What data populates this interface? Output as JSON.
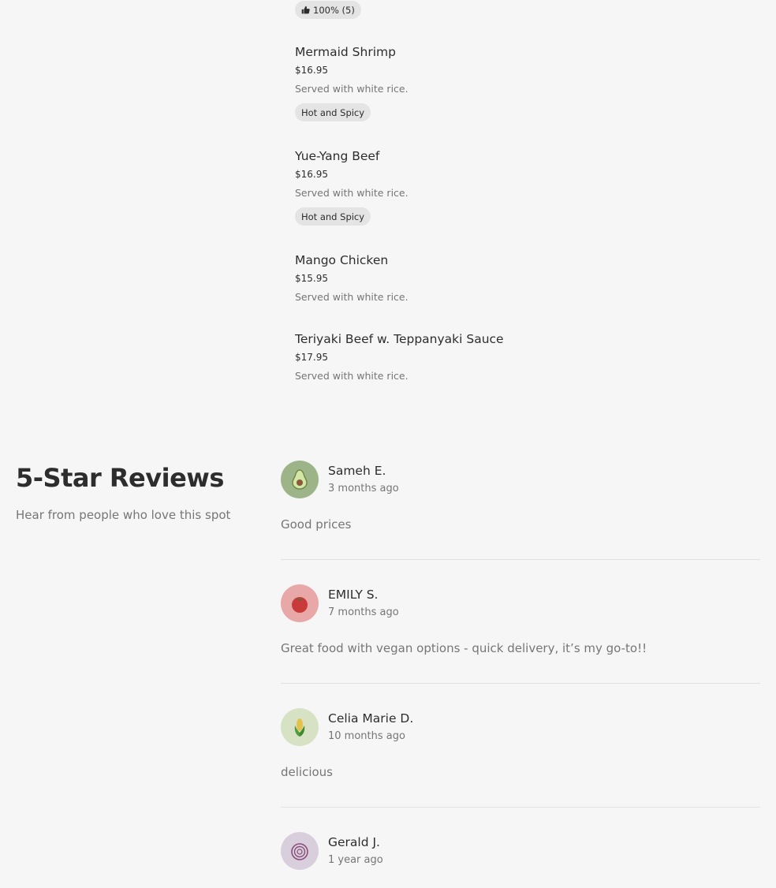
{
  "rating_badge": {
    "icon": "thumbs-up-icon",
    "text": "100% (5)"
  },
  "menu_items": [
    {
      "name": "Mermaid Shrimp",
      "price": "$16.95",
      "description": "Served with white rice.",
      "tag": "Hot and Spicy"
    },
    {
      "name": "Yue-Yang Beef",
      "price": "$16.95",
      "description": "Served with white rice.",
      "tag": "Hot and Spicy"
    },
    {
      "name": "Mango Chicken",
      "price": "$15.95",
      "description": "Served with white rice."
    },
    {
      "name": "Teriyaki Beef w. Teppanyaki Sauce",
      "price": "$17.95",
      "description": "Served with white rice."
    }
  ],
  "reviews_section": {
    "title": "5-Star Reviews",
    "subtitle": "Hear from people who love this spot"
  },
  "reviews": [
    {
      "name": "Sameh E.",
      "date": "3 months ago",
      "text": "Good prices",
      "avatar_icon": "avocado-icon",
      "avatar_bg": "#9cb488"
    },
    {
      "name": "EMILY S.",
      "date": "7 months ago",
      "text": "Great food with vegan options - quick delivery, it’s my go-to!!",
      "avatar_icon": "tomato-icon",
      "avatar_bg": "#e8a8a8"
    },
    {
      "name": "Celia Marie D.",
      "date": "10 months ago",
      "text": "delicious",
      "avatar_icon": "corn-icon",
      "avatar_bg": "#d7e2c4"
    },
    {
      "name": "Gerald J.",
      "date": "1 year ago",
      "text": "",
      "avatar_icon": "onion-icon",
      "avatar_bg": "#d9cfdc"
    }
  ],
  "colors": {
    "background": "#f6f6f6",
    "text_primary": "#2d2d2d",
    "text_secondary": "#767676",
    "badge_bg": "#e4e4e4"
  }
}
